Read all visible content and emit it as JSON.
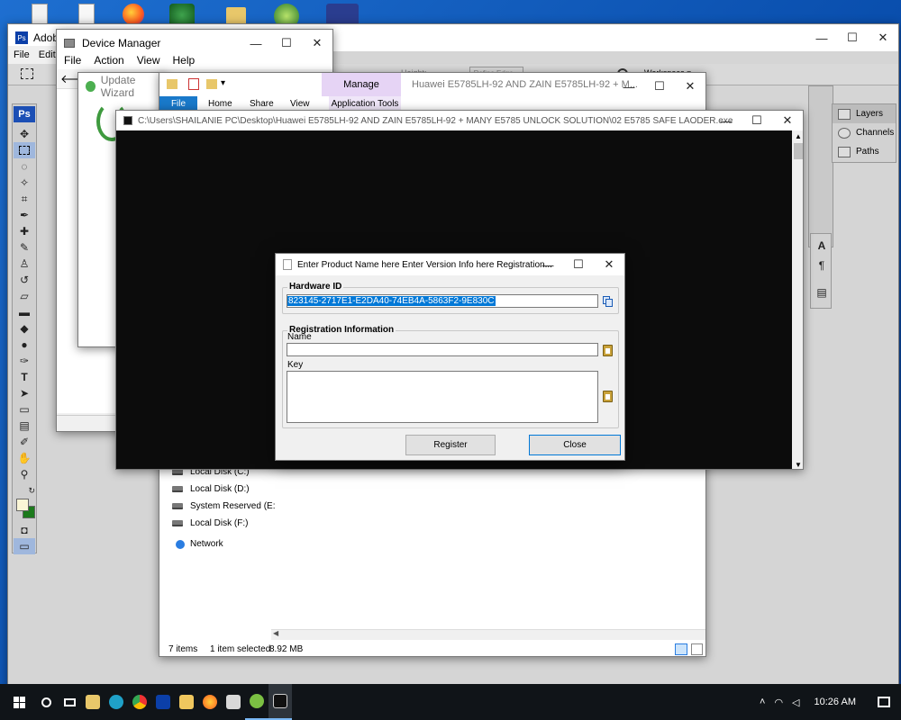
{
  "desktop": {
    "accent": "#1565c0"
  },
  "photoshop": {
    "title": "Adobe",
    "menu": [
      "File",
      "Edit"
    ],
    "logo": "Ps",
    "options": {
      "height_label": "Height:",
      "refine_label": "Refine Edge...",
      "workspace_label": "Workspace ▾"
    },
    "panels": [
      "Layers",
      "Channels",
      "Paths"
    ]
  },
  "device_manager": {
    "title": "Device Manager",
    "menu": [
      "File",
      "Action",
      "View",
      "Help"
    ]
  },
  "update_wizard": {
    "title": "Update Wizard"
  },
  "explorer": {
    "title": "Huawei E5785LH-92 AND ZAIN E5785LH-92 + M...",
    "ribbon_context": "Manage",
    "tabs": [
      "File",
      "Home",
      "Share",
      "View",
      "Application Tools"
    ],
    "tree": [
      "Local Disk (C:)",
      "Local Disk (D:)",
      "System Reserved (E:",
      "Local Disk (F:)"
    ],
    "network": "Network",
    "status": {
      "items": "7 items",
      "selected": "1 item selected",
      "size": "8.92 MB"
    }
  },
  "console": {
    "title": "C:\\Users\\SHAILANIE PC\\Desktop\\Huawei E5785LH-92 AND ZAIN E5785LH-92 + MANY E5785 UNLOCK SOLUTION\\02 E5785 SAFE LAODER.exe"
  },
  "dialog": {
    "title": "Enter Product Name here Enter Version Info here Registration...",
    "hardware_group": "Hardware ID",
    "hardware_id": "823145-2717E1-E2DA40-74EB4A-5863F2-9E830C",
    "registration_group": "Registration Information",
    "name_label": "Name",
    "name_value": "",
    "key_label": "Key",
    "key_value": "",
    "register_label": "Register",
    "close_label": "Close"
  },
  "taskbar": {
    "time": "10:26 AM",
    "icons": [
      "start-icon",
      "search-icon",
      "task-view-icon",
      "file-explorer-icon",
      "edge-icon",
      "chrome-icon",
      "photoshop-icon",
      "folder-icon",
      "firefox-icon",
      "media-icon",
      "wizard-icon",
      "console-icon"
    ]
  }
}
